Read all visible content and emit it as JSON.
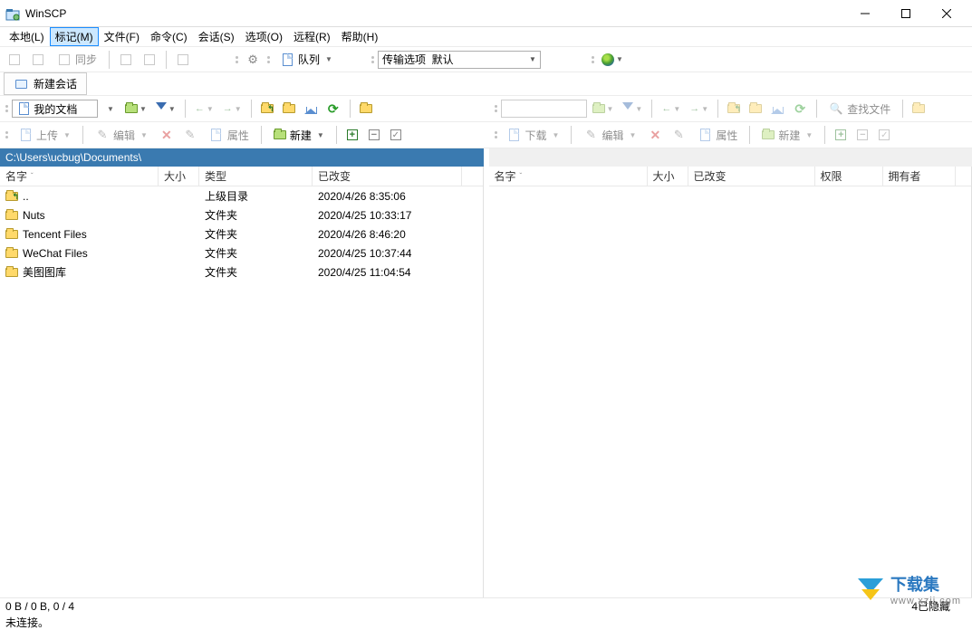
{
  "window": {
    "title": "WinSCP"
  },
  "menu": {
    "local": "本地(L)",
    "mark": "标记(M)",
    "file": "文件(F)",
    "command": "命令(C)",
    "session": "会话(S)",
    "options": "选项(O)",
    "remote": "远程(R)",
    "help": "帮助(H)"
  },
  "toolbar_main": {
    "sync": "同步",
    "queue": "队列",
    "transfer_label": "传输选项",
    "transfer_value": "默认"
  },
  "session_tab": {
    "new_session": "新建会话"
  },
  "left_nav": {
    "drive": "我的文档"
  },
  "left_actions": {
    "upload": "上传",
    "edit": "编辑",
    "props": "属性",
    "new": "新建"
  },
  "right_actions": {
    "download": "下载",
    "edit": "编辑",
    "props": "属性",
    "new": "新建",
    "find": "查找文件"
  },
  "left_path": "C:\\Users\\ucbug\\Documents\\",
  "right_path": "",
  "columns_left": {
    "name": "名字",
    "size": "大小",
    "type": "类型",
    "changed": "已改变"
  },
  "columns_right": {
    "name": "名字",
    "size": "大小",
    "changed": "已改变",
    "rights": "权限",
    "owner": "拥有者"
  },
  "left_files": [
    {
      "name": "..",
      "type": "上级目录",
      "changed": "2020/4/26  8:35:06",
      "icon": "up"
    },
    {
      "name": "Nuts",
      "type": "文件夹",
      "changed": "2020/4/25  10:33:17",
      "icon": "folder"
    },
    {
      "name": "Tencent Files",
      "type": "文件夹",
      "changed": "2020/4/26  8:46:20",
      "icon": "folder"
    },
    {
      "name": "WeChat Files",
      "type": "文件夹",
      "changed": "2020/4/25  10:37:44",
      "icon": "folder"
    },
    {
      "name": "美图图库",
      "type": "文件夹",
      "changed": "2020/4/25  11:04:54",
      "icon": "folder"
    }
  ],
  "right_files": [],
  "status": {
    "selection": "0 B / 0 B, 0 / 4",
    "hidden": "4已隐藏",
    "connection": "未连接。"
  },
  "watermark": {
    "line1": "下载集",
    "line2": "www.xzji.com"
  }
}
